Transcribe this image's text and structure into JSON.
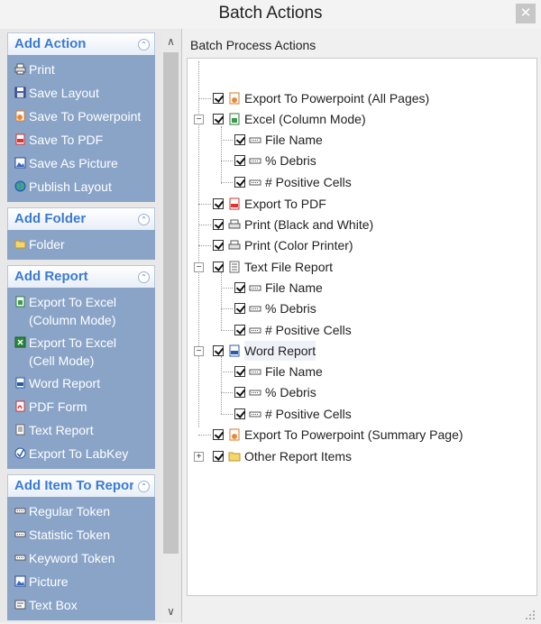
{
  "window": {
    "title": "Batch Actions",
    "close_glyph": "✕"
  },
  "left": {
    "sections": [
      {
        "title": "Add Action",
        "items": [
          {
            "label": "Print",
            "icon": "printer-icon"
          },
          {
            "label": "Save Layout",
            "icon": "floppy-icon"
          },
          {
            "label": "Save To Powerpoint",
            "icon": "powerpoint-icon"
          },
          {
            "label": "Save To PDF",
            "icon": "pdf-icon"
          },
          {
            "label": "Save As Picture",
            "icon": "picture-icon"
          },
          {
            "label": "Publish Layout",
            "icon": "globe-icon"
          }
        ]
      },
      {
        "title": "Add Folder",
        "items": [
          {
            "label": "Folder",
            "icon": "folder-icon"
          }
        ]
      },
      {
        "title": "Add Report",
        "items": [
          {
            "label_1": "Export To Excel",
            "label_2": "(Column Mode)",
            "icon": "excel-icon"
          },
          {
            "label_1": "Export To Excel",
            "label_2": "(Cell Mode)",
            "icon": "excel-green-icon"
          },
          {
            "label": "Word Report",
            "icon": "word-icon"
          },
          {
            "label": "PDF Form",
            "icon": "pdf-form-icon"
          },
          {
            "label": "Text Report",
            "icon": "text-report-icon"
          },
          {
            "label": "Export To LabKey",
            "icon": "labkey-icon"
          }
        ]
      },
      {
        "title": "Add Item To Report",
        "items": [
          {
            "label": "Regular Token",
            "icon": "token-icon"
          },
          {
            "label": "Statistic Token",
            "icon": "token-icon"
          },
          {
            "label": "Keyword Token",
            "icon": "token-icon"
          },
          {
            "label": "Picture",
            "icon": "picture-icon"
          },
          {
            "label": "Text Box",
            "icon": "textbox-icon"
          }
        ]
      }
    ]
  },
  "right": {
    "header": "Batch Process Actions",
    "tree": [
      {
        "label": "Export To Powerpoint (All Pages)",
        "icon": "powerpoint-icon"
      },
      {
        "label": "Excel (Column Mode)",
        "icon": "excel-icon",
        "expanded": true
      },
      {
        "label": "File Name",
        "icon": "token-icon"
      },
      {
        "label": "% Debris",
        "icon": "token-icon"
      },
      {
        "label": "# Positive Cells",
        "icon": "token-icon"
      },
      {
        "label": "Export To PDF",
        "icon": "pdf-icon"
      },
      {
        "label": "Print (Black and White)",
        "icon": "printer-icon"
      },
      {
        "label": "Print (Color Printer)",
        "icon": "printer-icon"
      },
      {
        "label": "Text File Report",
        "icon": "text-report-icon",
        "expanded": true
      },
      {
        "label": "File Name",
        "icon": "token-icon"
      },
      {
        "label": "% Debris",
        "icon": "token-icon"
      },
      {
        "label": "# Positive Cells",
        "icon": "token-icon"
      },
      {
        "label": "Word Report",
        "icon": "word-icon",
        "expanded": true,
        "selected": true
      },
      {
        "label": "File Name",
        "icon": "token-icon"
      },
      {
        "label": "% Debris",
        "icon": "token-icon"
      },
      {
        "label": "# Positive Cells",
        "icon": "token-icon"
      },
      {
        "label": "Export To Powerpoint (Summary Page)",
        "icon": "powerpoint-icon"
      },
      {
        "label": "Other Report Items",
        "icon": "folder-icon",
        "expanded": false
      }
    ]
  }
}
